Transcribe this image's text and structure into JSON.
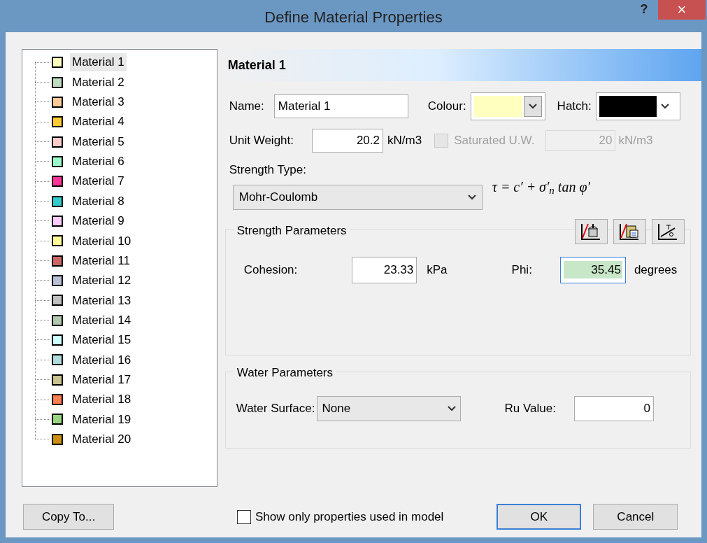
{
  "window": {
    "title": "Define Material Properties",
    "help": "?",
    "close": "×"
  },
  "materials": [
    {
      "label": "Material 1",
      "color": "#ffffc0",
      "selected": true
    },
    {
      "label": "Material 2",
      "color": "#c0dcc0",
      "selected": false
    },
    {
      "label": "Material 3",
      "color": "#ffcc99",
      "selected": false
    },
    {
      "label": "Material 4",
      "color": "#ffcc33",
      "selected": false
    },
    {
      "label": "Material 5",
      "color": "#ffcccc",
      "selected": false
    },
    {
      "label": "Material 6",
      "color": "#99ffcc",
      "selected": false
    },
    {
      "label": "Material 7",
      "color": "#ff3399",
      "selected": false
    },
    {
      "label": "Material 8",
      "color": "#33cccc",
      "selected": false
    },
    {
      "label": "Material 9",
      "color": "#ffccff",
      "selected": false
    },
    {
      "label": "Material 10",
      "color": "#ffff99",
      "selected": false
    },
    {
      "label": "Material 11",
      "color": "#cc6666",
      "selected": false
    },
    {
      "label": "Material 12",
      "color": "#b8c0d8",
      "selected": false
    },
    {
      "label": "Material 13",
      "color": "#c0c0c0",
      "selected": false
    },
    {
      "label": "Material 14",
      "color": "#b0c8b0",
      "selected": false
    },
    {
      "label": "Material 15",
      "color": "#ccffff",
      "selected": false
    },
    {
      "label": "Material 16",
      "color": "#b0dcdc",
      "selected": false
    },
    {
      "label": "Material 17",
      "color": "#c8c490",
      "selected": false
    },
    {
      "label": "Material 18",
      "color": "#ff7f50",
      "selected": false
    },
    {
      "label": "Material 19",
      "color": "#99d680",
      "selected": false
    },
    {
      "label": "Material 20",
      "color": "#cc8e14",
      "selected": false
    }
  ],
  "header": "Material 1",
  "name": {
    "label": "Name:",
    "value": "Material 1"
  },
  "colour": {
    "label": "Colour:",
    "color": "#ffffc0"
  },
  "hatch": {
    "label": "Hatch:",
    "color": "#000000"
  },
  "unit_weight": {
    "label": "Unit Weight:",
    "value": "20.2",
    "unit": "kN/m3"
  },
  "saturated": {
    "label": "Saturated U.W.",
    "checked": false,
    "disabled": true,
    "value": "20",
    "unit": "kN/m3"
  },
  "strength_type": {
    "label": "Strength Type:",
    "value": "Mohr-Coulomb",
    "formula": "τ = c′ + σ′$_{n}$ tan φ′"
  },
  "strength_parameters": {
    "title": "Strength Parameters",
    "cohesion": {
      "label": "Cohesion:",
      "value": "23.33",
      "unit": "kPa"
    },
    "phi": {
      "label": "Phi:",
      "value": "35.45",
      "unit": "degrees",
      "focused": true
    }
  },
  "water_parameters": {
    "title": "Water Parameters",
    "surface": {
      "label": "Water Surface:",
      "value": "None"
    },
    "ru": {
      "label": "Ru Value:",
      "value": "0"
    }
  },
  "copy_button": "Copy To...",
  "show_only": {
    "label": "Show only properties used in model",
    "checked": false
  },
  "buttons": [
    {
      "label": "OK",
      "kind": "default"
    },
    {
      "label": "Cancel",
      "kind": "normal"
    }
  ]
}
